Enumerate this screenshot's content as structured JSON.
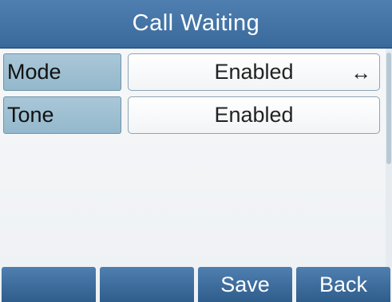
{
  "title": "Call  Waiting",
  "settings": [
    {
      "label": "Mode",
      "value": "Enabled",
      "selector": "↔"
    },
    {
      "label": "Tone",
      "value": "Enabled"
    }
  ],
  "softkeys": [
    "",
    "",
    "Save",
    "Back"
  ],
  "colors": {
    "title_bar": "#3a6a9c",
    "label_bg": "#a9c7d8",
    "softkey_bg": "#3a6a9c"
  }
}
